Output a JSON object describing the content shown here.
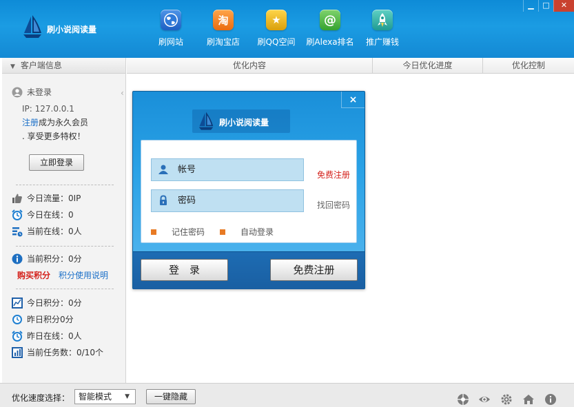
{
  "app": {
    "logo_text": "刷小说阅读量",
    "nav": [
      {
        "label": "刷网站",
        "icon": "globe-icon",
        "color": "#2b6fd0"
      },
      {
        "label": "刷淘宝店",
        "icon": "taobao-icon",
        "glyph": "淘",
        "color": "#f27a22"
      },
      {
        "label": "刷QQ空间",
        "icon": "star-icon",
        "glyph": "★",
        "color": "#e8b00f"
      },
      {
        "label": "刷Alexa排名",
        "icon": "alexa-icon",
        "glyph": "@",
        "color": "#49b445"
      },
      {
        "label": "推广赚钱",
        "icon": "rocket-icon",
        "color": "#33a9a0"
      }
    ],
    "window_buttons": {
      "minimize": "▁",
      "maximize": "□",
      "close": "✕"
    }
  },
  "sidebar": {
    "header": "客户端信息",
    "user_status": "未登录",
    "ip": "IP: 127.0.0.1",
    "register_link": "注册",
    "register_suffix": "成为永久会员",
    "privilege_text": ". 享受更多特权！",
    "login_button": "立即登录",
    "stats1": [
      {
        "label": "今日流量：0IP",
        "icon": "thumbs-up-icon"
      },
      {
        "label": "今日在线：0",
        "icon": "alarm-clock-icon"
      },
      {
        "label": "当前在线：0人",
        "icon": "online-list-icon"
      }
    ],
    "points": {
      "label": "当前积分：0分",
      "icon": "info-icon"
    },
    "buy_points": "购买积分",
    "points_help": "积分使用说明",
    "stats2": [
      {
        "label": "今日积分：0分",
        "icon": "chart-icon"
      },
      {
        "label": "昨日积分0分",
        "icon": "clock-icon"
      },
      {
        "label": "昨日在线：0人",
        "icon": "alarm-clock-icon"
      },
      {
        "label": "当前任务数：0/10个",
        "icon": "task-chart-icon"
      }
    ]
  },
  "table": {
    "columns": [
      "优化内容",
      "今日优化进度",
      "优化控制"
    ]
  },
  "bottom": {
    "speed_label": "优化速度选择：",
    "speed_value": "智能模式",
    "hide_button": "一键隐藏",
    "icons": [
      "network-icon",
      "eye-icon",
      "settings-icon",
      "home-icon",
      "about-icon"
    ]
  },
  "login_dialog": {
    "logo_text": "刷小说阅读量",
    "close": "×",
    "account_placeholder": "帐号",
    "password_placeholder": "密码",
    "free_register_link": "免费注册",
    "find_password_link": "找回密码",
    "remember_password": "记住密码",
    "auto_login": "自动登录",
    "login_button": "登　录",
    "register_button": "免费注册"
  }
}
